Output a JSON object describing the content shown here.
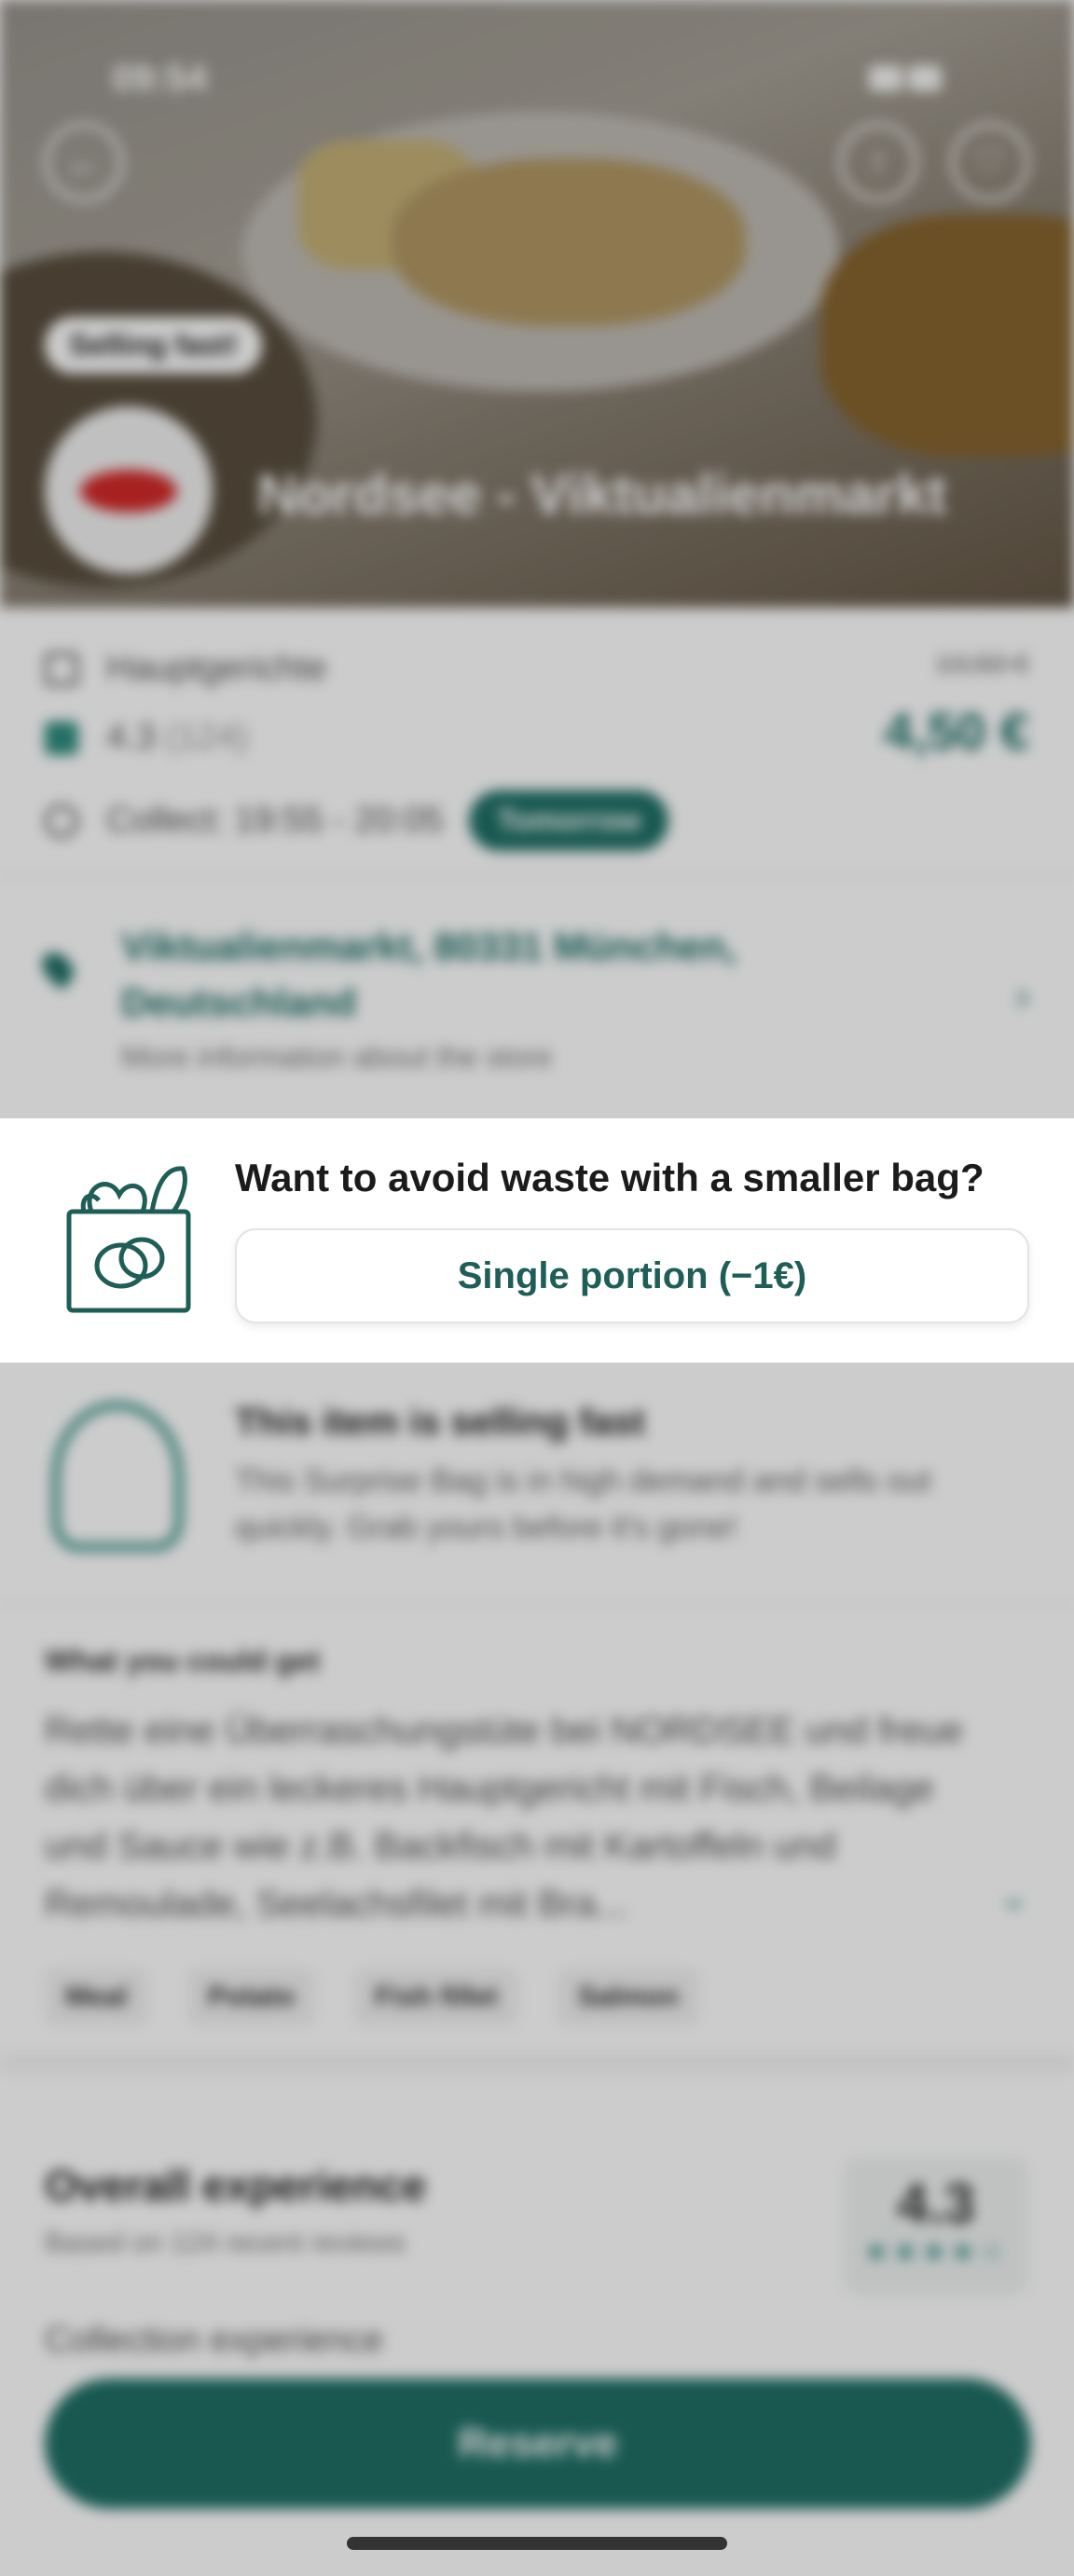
{
  "status": {
    "time": "09:54"
  },
  "hero": {
    "badge": "Selling fast!",
    "store_name": "Nordsee - Viktualienmarkt"
  },
  "info": {
    "category": "Hauptgerichte",
    "rating": "4.3",
    "rating_count": "(124)",
    "collect": "Collect: 19:55 - 20:05",
    "collect_day": "Tomorrow",
    "price_old": "13,50 €",
    "price_new": "4,50 €"
  },
  "address": {
    "text": "Viktualienmarkt, 80331 München, Deutschland",
    "sub": "More information about the store"
  },
  "banner": {
    "title": "Want to avoid waste with a smaller bag?",
    "button_label": "Single portion (−1€)"
  },
  "selling_fast": {
    "title": "This item is selling fast",
    "text": "This Surprise Bag is in high demand and sells out quickly. Grab yours before it's gone!"
  },
  "description": {
    "heading": "What you could get",
    "text": "Rette eine Überraschungstüte bei NORDSEE und freue dich über ein leckeres Hauptgericht mit Fisch, Beilage und Sauce wie z.B. Backfisch mit Kartoffeln und Remoulade, Seelachsfilet mit Bra...",
    "tags": [
      "Meal",
      "Potato",
      "Fish fillet",
      "Salmon"
    ]
  },
  "reviews": {
    "title": "Overall experience",
    "subtitle": "Based on 124 recent reviews",
    "score": "4.3",
    "stars": "★★★★☆",
    "next": "Collection experience"
  },
  "actions": {
    "reserve": "Reserve"
  },
  "colors": {
    "accent": "#1f6f66",
    "brand_red": "#d22a2a"
  }
}
